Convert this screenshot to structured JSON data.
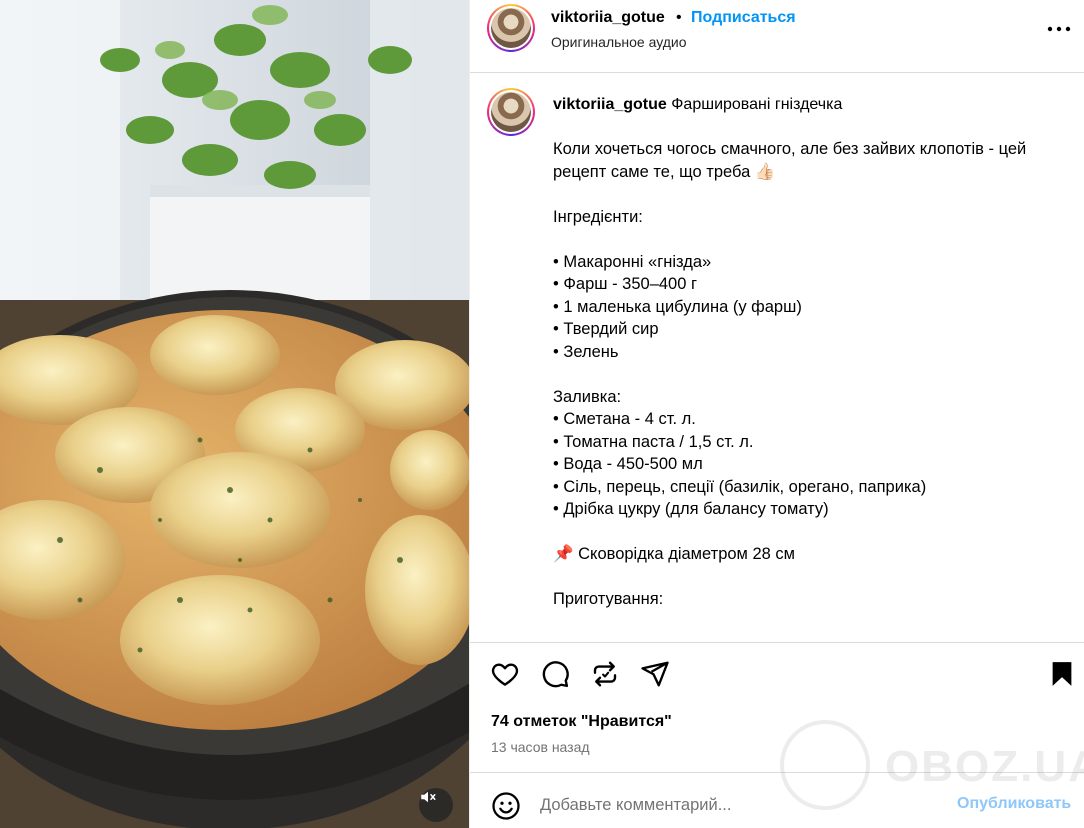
{
  "header": {
    "username": "viktoriia_gotue",
    "separator": "•",
    "follow_label": "Подписаться",
    "audio_label": "Оригинальное аудио",
    "more_icon": "more-horizontal-icon"
  },
  "caption": {
    "username": "viktoriia_gotue",
    "title": "Фаршировані гніздечка",
    "lines": [
      "Коли хочеться чогось смачного, але без зайвих клопотів - цей",
      "рецепт саме те, що треба 👍🏻",
      "",
      "Інгредієнти:",
      "",
      "• Макаронні «гнізда»",
      "• Фарш - 350–400 г",
      "• 1 маленька цибулина (у фарш)",
      "• Твердий сир",
      "• Зелень",
      "",
      "Заливка:",
      "• Сметана - 4 ст. л.",
      "• Томатна паста / 1,5 ст. л.",
      "• Вода - 450-500 мл",
      "• Сіль, перець, спеції (базилік, орегано, паприка)",
      "• Дрібка цукру (для балансу томату)",
      "",
      "📌 Сковорідка діаметром 28 см",
      "",
      "Приготування:"
    ]
  },
  "actions": {
    "icons": [
      "heart-icon",
      "comment-icon",
      "repost-icon",
      "share-icon",
      "bookmark-icon"
    ],
    "likes_text": "74 отметок \"Нравится\"",
    "time_text": "13 часов назад"
  },
  "comment": {
    "placeholder": "Добавьте комментарий...",
    "publish_label": "Опубликовать",
    "emoji_icon": "emoji-icon"
  },
  "media": {
    "mute_icon": "muted-speaker-icon"
  },
  "watermark": {
    "text": "OBOZ.UA"
  },
  "colors": {
    "accent": "#0095f6",
    "publish_disabled": "#8ec7fa",
    "muted_text": "#737373",
    "divider": "#dbdbdb"
  }
}
